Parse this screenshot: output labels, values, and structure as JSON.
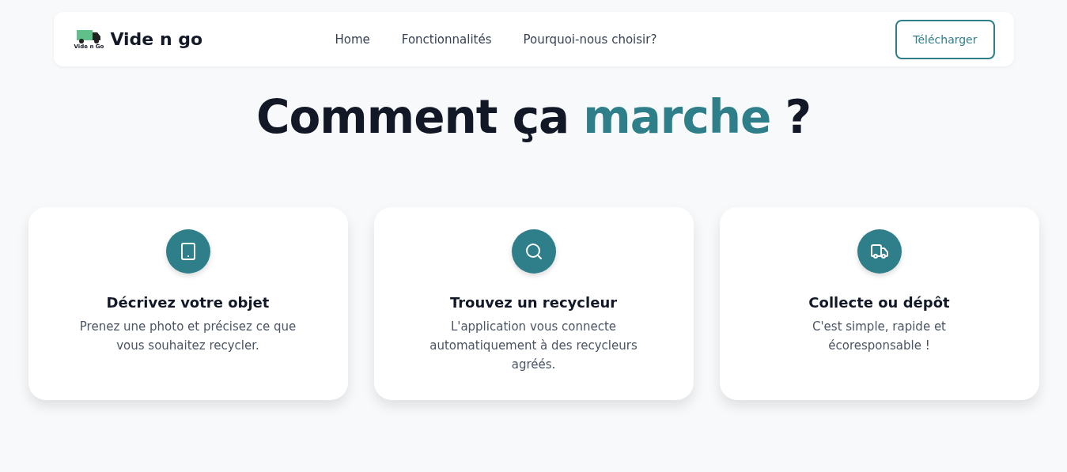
{
  "navbar": {
    "logo_caption": "Vide n Go",
    "brand": "Vide n go",
    "links": [
      {
        "label": "Home"
      },
      {
        "label": "Fonctionnalités"
      },
      {
        "label": "Pourquoi-nous choisir?"
      }
    ],
    "cta": "Télécharger"
  },
  "heading": [
    {
      "text": "Comment ça",
      "kind": "plain"
    },
    {
      "text": "marche",
      "kind": "accent"
    },
    {
      "text": "?",
      "kind": "plain"
    }
  ],
  "cards": [
    {
      "title": "Décrivez votre objet",
      "text": "Prenez une photo et précisez ce que vous souhaitez recycler."
    },
    {
      "title": "Trouvez un recycleur",
      "text": "L'application vous connecte automatiquement à des recycleurs agréés."
    },
    {
      "title": "Collecte ou dépôt",
      "text": "C'est simple, rapide et écoresponsable !"
    }
  ]
}
